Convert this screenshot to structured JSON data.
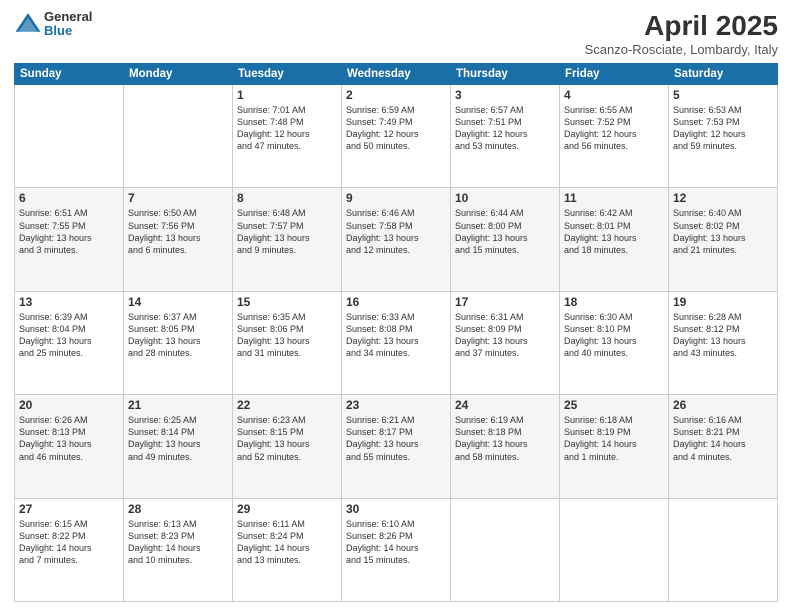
{
  "header": {
    "logo_general": "General",
    "logo_blue": "Blue",
    "title": "April 2025",
    "subtitle": "Scanzo-Rosciate, Lombardy, Italy"
  },
  "weekdays": [
    "Sunday",
    "Monday",
    "Tuesday",
    "Wednesday",
    "Thursday",
    "Friday",
    "Saturday"
  ],
  "weeks": [
    [
      {
        "day": "",
        "info": ""
      },
      {
        "day": "",
        "info": ""
      },
      {
        "day": "1",
        "info": "Sunrise: 7:01 AM\nSunset: 7:48 PM\nDaylight: 12 hours\nand 47 minutes."
      },
      {
        "day": "2",
        "info": "Sunrise: 6:59 AM\nSunset: 7:49 PM\nDaylight: 12 hours\nand 50 minutes."
      },
      {
        "day": "3",
        "info": "Sunrise: 6:57 AM\nSunset: 7:51 PM\nDaylight: 12 hours\nand 53 minutes."
      },
      {
        "day": "4",
        "info": "Sunrise: 6:55 AM\nSunset: 7:52 PM\nDaylight: 12 hours\nand 56 minutes."
      },
      {
        "day": "5",
        "info": "Sunrise: 6:53 AM\nSunset: 7:53 PM\nDaylight: 12 hours\nand 59 minutes."
      }
    ],
    [
      {
        "day": "6",
        "info": "Sunrise: 6:51 AM\nSunset: 7:55 PM\nDaylight: 13 hours\nand 3 minutes."
      },
      {
        "day": "7",
        "info": "Sunrise: 6:50 AM\nSunset: 7:56 PM\nDaylight: 13 hours\nand 6 minutes."
      },
      {
        "day": "8",
        "info": "Sunrise: 6:48 AM\nSunset: 7:57 PM\nDaylight: 13 hours\nand 9 minutes."
      },
      {
        "day": "9",
        "info": "Sunrise: 6:46 AM\nSunset: 7:58 PM\nDaylight: 13 hours\nand 12 minutes."
      },
      {
        "day": "10",
        "info": "Sunrise: 6:44 AM\nSunset: 8:00 PM\nDaylight: 13 hours\nand 15 minutes."
      },
      {
        "day": "11",
        "info": "Sunrise: 6:42 AM\nSunset: 8:01 PM\nDaylight: 13 hours\nand 18 minutes."
      },
      {
        "day": "12",
        "info": "Sunrise: 6:40 AM\nSunset: 8:02 PM\nDaylight: 13 hours\nand 21 minutes."
      }
    ],
    [
      {
        "day": "13",
        "info": "Sunrise: 6:39 AM\nSunset: 8:04 PM\nDaylight: 13 hours\nand 25 minutes."
      },
      {
        "day": "14",
        "info": "Sunrise: 6:37 AM\nSunset: 8:05 PM\nDaylight: 13 hours\nand 28 minutes."
      },
      {
        "day": "15",
        "info": "Sunrise: 6:35 AM\nSunset: 8:06 PM\nDaylight: 13 hours\nand 31 minutes."
      },
      {
        "day": "16",
        "info": "Sunrise: 6:33 AM\nSunset: 8:08 PM\nDaylight: 13 hours\nand 34 minutes."
      },
      {
        "day": "17",
        "info": "Sunrise: 6:31 AM\nSunset: 8:09 PM\nDaylight: 13 hours\nand 37 minutes."
      },
      {
        "day": "18",
        "info": "Sunrise: 6:30 AM\nSunset: 8:10 PM\nDaylight: 13 hours\nand 40 minutes."
      },
      {
        "day": "19",
        "info": "Sunrise: 6:28 AM\nSunset: 8:12 PM\nDaylight: 13 hours\nand 43 minutes."
      }
    ],
    [
      {
        "day": "20",
        "info": "Sunrise: 6:26 AM\nSunset: 8:13 PM\nDaylight: 13 hours\nand 46 minutes."
      },
      {
        "day": "21",
        "info": "Sunrise: 6:25 AM\nSunset: 8:14 PM\nDaylight: 13 hours\nand 49 minutes."
      },
      {
        "day": "22",
        "info": "Sunrise: 6:23 AM\nSunset: 8:15 PM\nDaylight: 13 hours\nand 52 minutes."
      },
      {
        "day": "23",
        "info": "Sunrise: 6:21 AM\nSunset: 8:17 PM\nDaylight: 13 hours\nand 55 minutes."
      },
      {
        "day": "24",
        "info": "Sunrise: 6:19 AM\nSunset: 8:18 PM\nDaylight: 13 hours\nand 58 minutes."
      },
      {
        "day": "25",
        "info": "Sunrise: 6:18 AM\nSunset: 8:19 PM\nDaylight: 14 hours\nand 1 minute."
      },
      {
        "day": "26",
        "info": "Sunrise: 6:16 AM\nSunset: 8:21 PM\nDaylight: 14 hours\nand 4 minutes."
      }
    ],
    [
      {
        "day": "27",
        "info": "Sunrise: 6:15 AM\nSunset: 8:22 PM\nDaylight: 14 hours\nand 7 minutes."
      },
      {
        "day": "28",
        "info": "Sunrise: 6:13 AM\nSunset: 8:23 PM\nDaylight: 14 hours\nand 10 minutes."
      },
      {
        "day": "29",
        "info": "Sunrise: 6:11 AM\nSunset: 8:24 PM\nDaylight: 14 hours\nand 13 minutes."
      },
      {
        "day": "30",
        "info": "Sunrise: 6:10 AM\nSunset: 8:26 PM\nDaylight: 14 hours\nand 15 minutes."
      },
      {
        "day": "",
        "info": ""
      },
      {
        "day": "",
        "info": ""
      },
      {
        "day": "",
        "info": ""
      }
    ]
  ]
}
